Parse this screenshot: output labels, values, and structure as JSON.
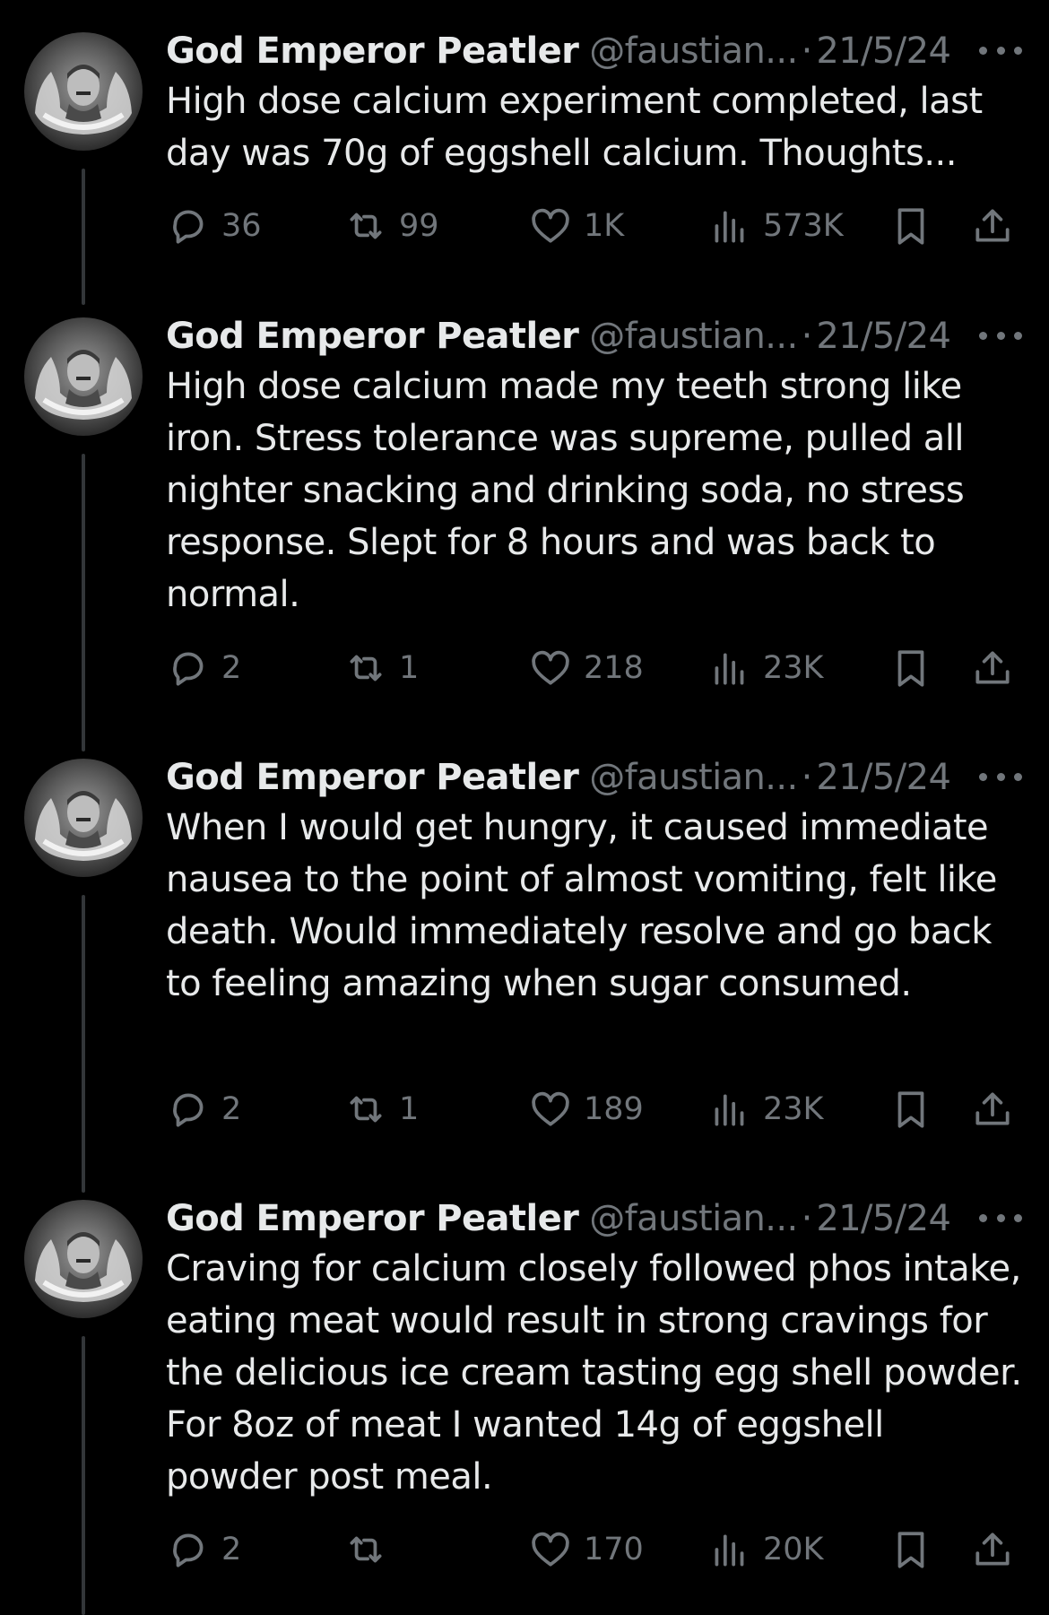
{
  "tweets": [
    {
      "author_name": "God Emperor Peatler",
      "handle": "@faustian...",
      "separator": "·",
      "date": "21/5/24",
      "text": "High dose calcium experiment completed, last day was 70g of eggshell calcium. Thoughts...",
      "replies": "36",
      "retweets": "99",
      "likes": "1K",
      "views": "573K"
    },
    {
      "author_name": "God Emperor Peatler",
      "handle": "@faustian...",
      "separator": "·",
      "date": "21/5/24",
      "text": "High dose calcium made my teeth strong like iron. Stress tolerance was supreme, pulled all nighter snacking and drinking soda, no stress response. Slept for 8 hours and was back to normal.",
      "replies": "2",
      "retweets": "1",
      "likes": "218",
      "views": "23K"
    },
    {
      "author_name": "God Emperor Peatler",
      "handle": "@faustian...",
      "separator": "·",
      "date": "21/5/24",
      "text": "When I would get hungry, it caused immediate nausea to the point of almost vomiting, felt like death. Would immediately resolve and go back to feeling amazing when sugar consumed.",
      "replies": "2",
      "retweets": "1",
      "likes": "189",
      "views": "23K"
    },
    {
      "author_name": "God Emperor Peatler",
      "handle": "@faustian...",
      "separator": "·",
      "date": "21/5/24",
      "text": "Craving for calcium closely followed phos intake, eating meat would result in strong cravings for the delicious ice cream tasting egg shell powder. For 8oz of meat I wanted 14g of eggshell powder post meal.",
      "replies": "2",
      "retweets": "",
      "likes": "170",
      "views": "20K"
    }
  ],
  "icons": {
    "reply": "reply-icon",
    "retweet": "retweet-icon",
    "like": "heart-icon",
    "views": "views-icon",
    "bookmark": "bookmark-icon",
    "share": "share-icon",
    "more": "more-options-icon"
  },
  "colors": {
    "background": "#000000",
    "text_primary": "#e7e9ea",
    "text_secondary": "#71767b",
    "thread_line": "#333639"
  }
}
